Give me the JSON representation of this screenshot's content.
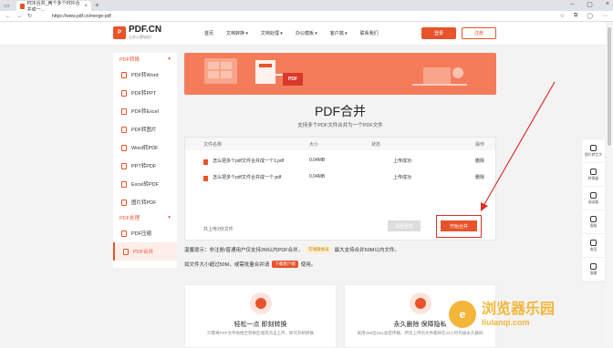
{
  "browser": {
    "tab_title": "PDF合并_两个多个PDF合并成一...",
    "url": "https://www.pdf.cn/merge-pdf"
  },
  "site": {
    "logo": "PDF.CN",
    "logo_sub": "让办公更轻松！",
    "nav": [
      "首页",
      "文档转换 ▾",
      "文档处理 ▾",
      "办公模板 ▾",
      "客户端 ▾",
      "联系我们"
    ],
    "login": "登录",
    "register": "注册"
  },
  "sidebar": {
    "sec1": "PDF转换",
    "sec1_items": [
      "PDF转Word",
      "PDF转PPT",
      "PDF转Excel",
      "PDF转图片",
      "Word转PDF",
      "PPT转PDF",
      "Excel转PDF",
      "图片转PDF"
    ],
    "sec2": "PDF处理",
    "sec2_items": [
      "PDF压缩",
      "PDF合并"
    ]
  },
  "main": {
    "banner_label": "PDF",
    "title": "PDF合并",
    "subtitle": "支持多个PDF文件合并为一个PDF文件",
    "table": {
      "headers": [
        "文件名称",
        "大小",
        "状态",
        "操作"
      ],
      "rows": [
        {
          "name": "怎么把多个pdf文件合并成一个1.pdf",
          "size": "0.04MB",
          "status": "上传成功",
          "op": "删除"
        },
        {
          "name": "怎么把多个pdf文件合并成一个.pdf",
          "size": "0.04MB",
          "status": "上传成功",
          "op": "删除"
        }
      ],
      "footer": "共上传2份文件",
      "clear": "清除全部",
      "merge": "开始合并"
    },
    "tip1_a": "温馨提示：非注册/普通用户仅支持2M以内PDF合并，",
    "tip1_badge": "在线版会员",
    "tip1_b": "最大支持合并50M以内文件。",
    "tip2_a": "如文件大小超过50M，或需批量合并请",
    "tip2_badge": "下载客户端",
    "tip2_b": "使用。",
    "cards": [
      {
        "title": "轻松一点 即刻转换",
        "desc": "只需将PDF文件拖拽至转换区域或点击上传，即可开始转换"
      },
      {
        "title": "永久删除 保障隐私",
        "desc": "采用256位SSL加密传输，所有上传的文件都将在24小时内被永久删除"
      }
    ]
  },
  "right_tools": [
    "图片转文字",
    "转换器",
    "阅读器",
    "客服",
    "电话",
    "收藏"
  ],
  "watermark": {
    "title": "浏览器乐园",
    "sub": "liulanqi.com",
    "logo": "e"
  },
  "colors": {
    "accent": "#e8532b"
  }
}
